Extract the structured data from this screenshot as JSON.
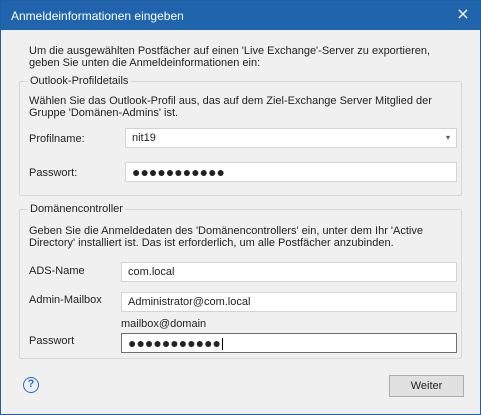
{
  "window": {
    "title": "Anmeldeinformationen eingeben",
    "close_glyph": "×"
  },
  "intro": "Um die ausgewählten Postfächer auf einen 'Live Exchange'-Server zu exportieren, geben Sie unten die Anmeldeinformationen ein:",
  "outlook": {
    "legend": "Outlook-Profildetails",
    "description": "Wählen Sie das Outlook-Profil aus, das auf dem Ziel-Exchange Server Mitglied der Gruppe 'Domänen-Admins' ist.",
    "profile_label": "Profilname:",
    "profile_value": "nit19",
    "password_label": "Passwort:",
    "password_value": "●●●●●●●●●●●"
  },
  "domain": {
    "legend": "Domänencontroller",
    "description": "Geben Sie die Anmeldedaten des 'Domänencontrollers' ein, unter dem Ihr 'Active Directory' installiert ist. Das ist erforderlich, um alle Postfächer anzubinden.",
    "ads_label": "ADS-Name",
    "ads_value": "com.local",
    "mailbox_label": "Admin-Mailbox",
    "mailbox_value": "Administrator@com.local",
    "mailbox_hint": "mailbox@domain",
    "password_label": "Passwort",
    "password_value": "●●●●●●●●●●●"
  },
  "footer": {
    "help_glyph": "?",
    "next_label": "Weiter"
  },
  "icons": {
    "dropdown": "▾"
  }
}
